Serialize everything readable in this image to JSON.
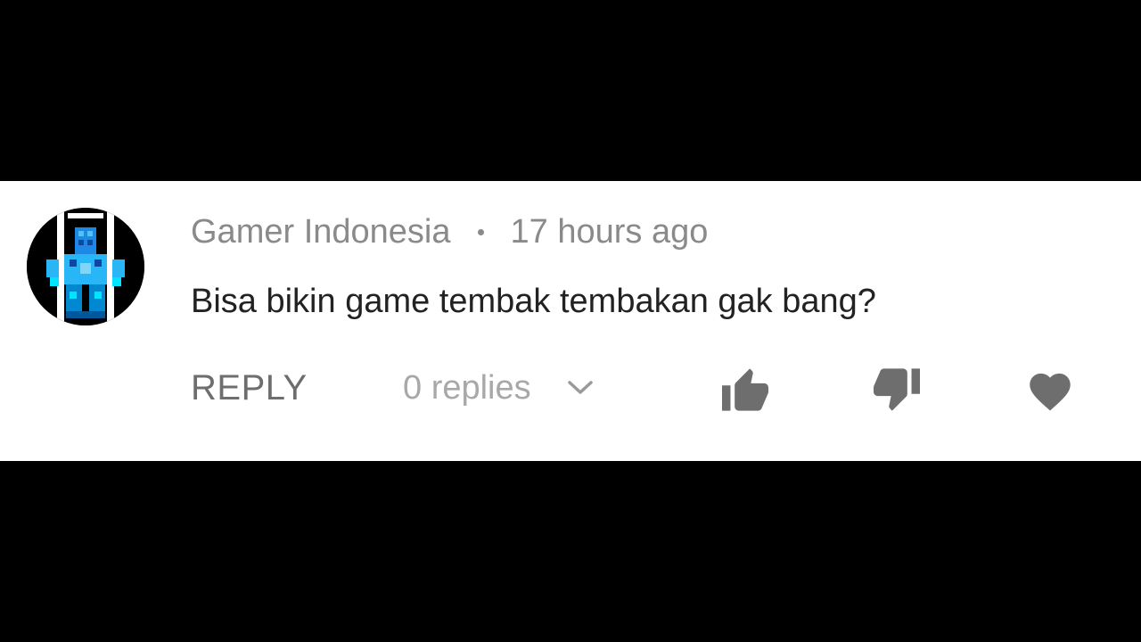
{
  "colors": {
    "background": "#000000",
    "card": "#ffffff",
    "meta_text": "#8a8a8a",
    "body_text": "#222222",
    "action_text": "#6e6e6e",
    "muted_text": "#a8a8a8",
    "icon": "#6e6e6e",
    "avatar_accent": "#29b6f6"
  },
  "comment": {
    "author": "Gamer Indonesia",
    "timestamp": "17 hours ago",
    "text": "Bisa bikin game tembak tembakan gak bang?",
    "avatar_icon": "pixel-character-avatar"
  },
  "actions": {
    "reply_label": "REPLY",
    "replies_label": "0 replies",
    "replies_icon": "chevron-down-icon",
    "like_icon": "thumbs-up-icon",
    "dislike_icon": "thumbs-down-icon",
    "heart_icon": "heart-icon"
  }
}
